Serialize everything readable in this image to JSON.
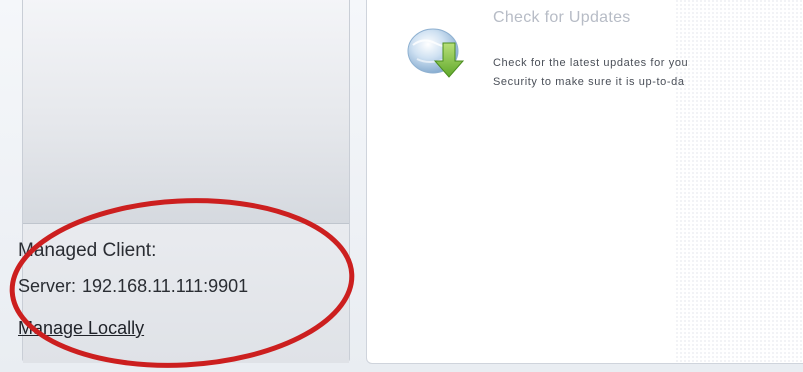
{
  "sidebar": {
    "status_title": "Managed Client:",
    "server_label": "Server:",
    "server_value": "192.168.11.111:9901",
    "manage_link": "Manage Locally"
  },
  "main": {
    "update": {
      "icon": "update-globe-arrow-icon",
      "title": "Check for Updates",
      "description_line1": "Check for the latest updates for you",
      "description_line2": "Security to make sure it is up-to-da"
    }
  },
  "annotation": {
    "shape": "ellipse",
    "color": "#cc1f1f"
  }
}
